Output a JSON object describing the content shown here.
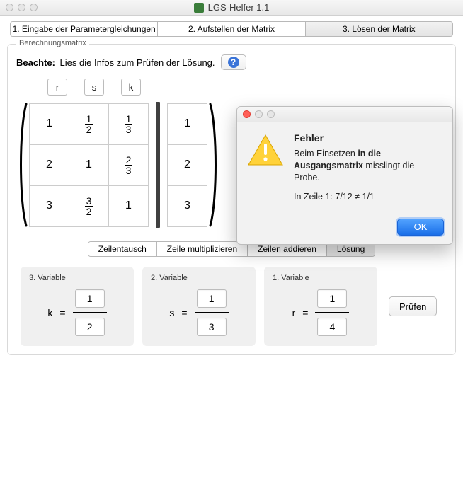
{
  "window": {
    "title": "LGS-Helfer 1.1"
  },
  "tabs": [
    {
      "label": "1. Eingabe der Parametergleichungen"
    },
    {
      "label": "2. Aufstellen der Matrix"
    },
    {
      "label": "3. Lösen der Matrix"
    }
  ],
  "activeTab": 2,
  "group": {
    "title": "Berechnungsmatrix"
  },
  "info": {
    "bold": "Beachte:",
    "text": "Lies die Infos zum Prüfen der Lösung."
  },
  "varHeaders": [
    "r",
    "s",
    "k"
  ],
  "matrixLeft": [
    [
      "1",
      {
        "n": "1",
        "d": "2"
      },
      {
        "n": "1",
        "d": "3"
      }
    ],
    [
      "2",
      "1",
      {
        "n": "2",
        "d": "3"
      }
    ],
    [
      "3",
      {
        "n": "3",
        "d": "2"
      },
      "1"
    ]
  ],
  "matrixRight": [
    [
      "1"
    ],
    [
      "2"
    ],
    [
      "3"
    ]
  ],
  "subTabs": [
    {
      "label": "Zeilentausch"
    },
    {
      "label": "Zeile multiplizieren"
    },
    {
      "label": "Zeilen addieren"
    },
    {
      "label": "Lösung"
    }
  ],
  "activeSubTab": 3,
  "solution": [
    {
      "title": "3. Variable",
      "sym": "k",
      "num": "1",
      "den": "2"
    },
    {
      "title": "2. Variable",
      "sym": "s",
      "num": "1",
      "den": "3"
    },
    {
      "title": "1. Variable",
      "sym": "r",
      "num": "1",
      "den": "4"
    }
  ],
  "checkLabel": "Prüfen",
  "dialog": {
    "title": "Fehler",
    "line1a": "Beim Einsetzen ",
    "line1b": "in die Ausgangsmatrix",
    "line1c": " misslingt die Probe.",
    "line2": "In Zeile 1: 7/12 ≠ 1/1",
    "ok": "OK"
  }
}
